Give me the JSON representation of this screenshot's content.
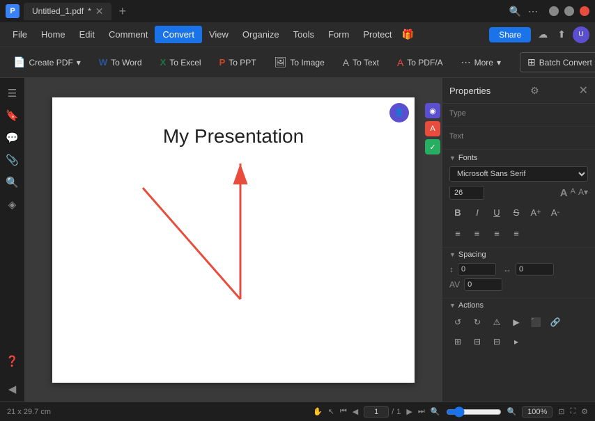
{
  "app": {
    "icon": "P",
    "tab_name": "Untitled_1.pdf",
    "tab_modified": "*"
  },
  "menu": {
    "file": "File",
    "home": "Home",
    "edit": "Edit",
    "comment": "Comment",
    "convert": "Convert",
    "view": "View",
    "organize": "Organize",
    "tools": "Tools",
    "form": "Form",
    "protect": "Protect",
    "share": "Share"
  },
  "toolbar": {
    "create_pdf": "Create PDF",
    "to_word": "To Word",
    "to_excel": "To Excel",
    "to_ppt": "To PPT",
    "to_image": "To Image",
    "to_text": "To Text",
    "to_pdfa": "To PDF/A",
    "more": "More",
    "batch_convert": "Batch Convert"
  },
  "pdf": {
    "title": "My Presentation"
  },
  "properties_panel": {
    "title": "Properties",
    "type_label": "Type",
    "type_value": "",
    "text_label": "Text",
    "text_value": "",
    "fonts_section": "Fonts",
    "font_name": "Microsoft Sans Serif",
    "font_size": "26",
    "spacing_section": "Spacing",
    "line_spacing_value": "0",
    "char_spacing_value": "0",
    "word_spacing_value": "0",
    "actions_section": "Actions"
  },
  "status_bar": {
    "dimensions": "21 x 29.7 cm",
    "page_current": "1",
    "page_total": "1",
    "zoom_level": "100%"
  }
}
